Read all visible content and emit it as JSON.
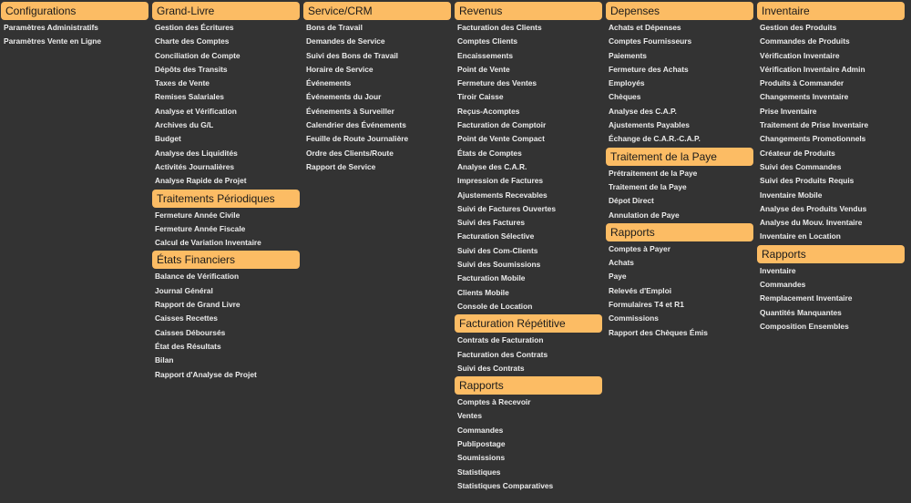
{
  "columns": [
    {
      "sections": [
        {
          "title": "Configurations",
          "items": [
            "Paramètres Administratifs",
            "Paramètres Vente en Ligne"
          ]
        }
      ]
    },
    {
      "sections": [
        {
          "title": "Grand-Livre",
          "items": [
            "Gestion des Écritures",
            "Charte des Comptes",
            "Conciliation de Compte",
            "Dépôts des Transits",
            "Taxes de Vente",
            "Remises Salariales",
            "Analyse et Vérification",
            "Archives du G/L",
            "Budget",
            "Analyse des Liquidités",
            "Activités Journalières",
            "Analyse Rapide de Projet"
          ]
        },
        {
          "title": "Traitements Périodiques",
          "items": [
            "Fermeture Année Civile",
            "Fermeture Année Fiscale",
            "Calcul de Variation Inventaire"
          ]
        },
        {
          "title": "États Financiers",
          "items": [
            "Balance de Vérification",
            "Journal Général",
            "Rapport de Grand Livre",
            "Caisses Recettes",
            "Caisses Déboursés",
            "État des Résultats",
            "Bilan",
            "Rapport d'Analyse de Projet"
          ]
        }
      ]
    },
    {
      "sections": [
        {
          "title": "Service/CRM",
          "items": [
            "Bons de Travail",
            "Demandes de Service",
            "Suivi des Bons de Travail",
            "Horaire de Service",
            "Événements",
            "Événements du Jour",
            "Événements à Surveiller",
            "Calendrier des Événements",
            "Feuille de Route Journalière",
            "Ordre des Clients/Route",
            "Rapport de Service"
          ]
        }
      ]
    },
    {
      "sections": [
        {
          "title": "Revenus",
          "items": [
            "Facturation des Clients",
            "Comptes Clients",
            "Encaissements",
            "Point de Vente",
            "Fermeture des Ventes",
            "Tiroir Caisse",
            "Reçus-Acomptes",
            "Facturation de Comptoir",
            "Point de Vente Compact",
            "États de Comptes",
            "Analyse des C.A.R.",
            "Impression de Factures",
            "Ajustements Recevables",
            "Suivi de Factures Ouvertes",
            "Suivi des Factures",
            "Facturation Sélective",
            "Suivi des Com-Clients",
            "Suivi des Soumissions",
            "Facturation Mobile",
            "Clients Mobile",
            "Console de Location"
          ]
        },
        {
          "title": "Facturation Répétitive",
          "items": [
            "Contrats de Facturation",
            "Facturation des Contrats",
            "Suivi des Contrats"
          ]
        },
        {
          "title": "Rapports",
          "items": [
            "Comptes à Recevoir",
            "Ventes",
            "Commandes",
            "Publipostage",
            "Soumissions",
            "Statistiques",
            "Statistiques Comparatives"
          ]
        }
      ]
    },
    {
      "sections": [
        {
          "title": "Depenses",
          "items": [
            "Achats et Dépenses",
            "Comptes Fournisseurs",
            "Paiements",
            "Fermeture des Achats",
            "Employés",
            "Chèques",
            "Analyse des C.A.P.",
            "Ajustements Payables",
            "Échange de C.A.R.-C.A.P."
          ]
        },
        {
          "title": "Traitement de la Paye",
          "items": [
            "Prétraitement de la Paye",
            "Traitement de la Paye",
            "Dépot Direct",
            "Annulation de Paye"
          ]
        },
        {
          "title": "Rapports",
          "items": [
            "Comptes à Payer",
            "Achats",
            "Paye",
            "Relevés d'Emploi",
            "Formulaires T4 et R1",
            "Commissions",
            "Rapport des Chèques Émis"
          ]
        }
      ]
    },
    {
      "sections": [
        {
          "title": "Inventaire",
          "items": [
            "Gestion des Produits",
            "Commandes de Produits",
            "Vérification Inventaire",
            "Vérification Inventaire Admin",
            "Produits à Commander",
            "Changements Inventaire",
            "Prise Inventaire",
            "Traitement de Prise Inventaire",
            "Changements Promotionnels",
            "Créateur de Produits",
            "Suivi des Commandes",
            "Suivi des Produits Requis",
            "Inventaire Mobile",
            "Analyse des Produits Vendus",
            "Analyse du Mouv. Inventaire",
            "Inventaire en Location"
          ]
        },
        {
          "title": "Rapports",
          "items": [
            "Inventaire",
            "Commandes",
            "Remplacement Inventaire",
            "Quantités Manquantes",
            "Composition Ensembles"
          ]
        }
      ]
    }
  ]
}
